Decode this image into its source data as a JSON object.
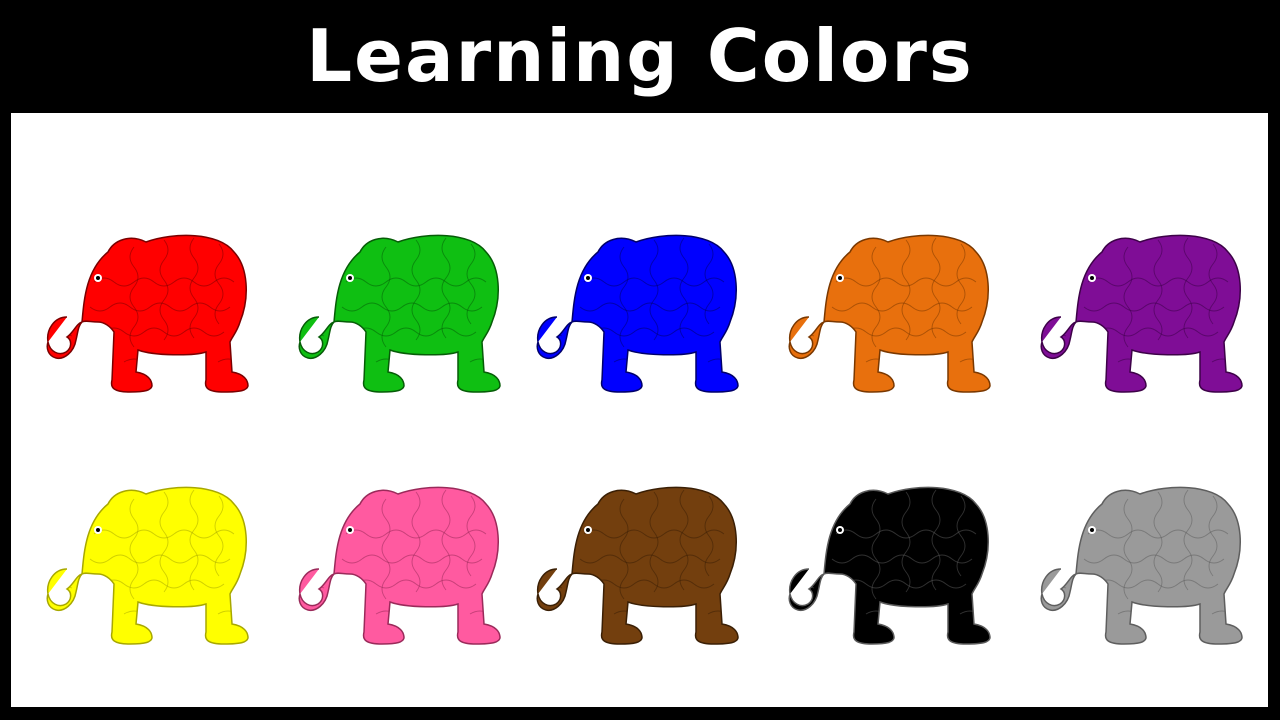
{
  "header": {
    "title": "Learning Colors"
  },
  "elephants": [
    {
      "color_name": "red",
      "fill": "#ff0000",
      "stroke": "#7a0000"
    },
    {
      "color_name": "green",
      "fill": "#0fbf12",
      "stroke": "#065c07"
    },
    {
      "color_name": "blue",
      "fill": "#0000ff",
      "stroke": "#00006a"
    },
    {
      "color_name": "orange",
      "fill": "#e8700d",
      "stroke": "#7a3800"
    },
    {
      "color_name": "purple",
      "fill": "#7f0d96",
      "stroke": "#3d0248"
    },
    {
      "color_name": "yellow",
      "fill": "#ffff00",
      "stroke": "#a8a800"
    },
    {
      "color_name": "pink",
      "fill": "#ff5aa0",
      "stroke": "#9a2a5a"
    },
    {
      "color_name": "brown",
      "fill": "#733f0e",
      "stroke": "#3a1f05"
    },
    {
      "color_name": "black",
      "fill": "#000000",
      "stroke": "#5a5a5a"
    },
    {
      "color_name": "gray",
      "fill": "#9a9a9a",
      "stroke": "#5e5e5e"
    }
  ]
}
